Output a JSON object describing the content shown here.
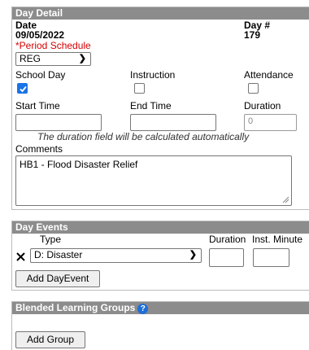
{
  "day_detail": {
    "title": "Day Detail",
    "date_label": "Date",
    "date_value": "09/05/2022",
    "day_num_label": "Day #",
    "day_num_value": "179",
    "period_schedule_label": "*Period Schedule",
    "period_schedule_value": "REG",
    "school_day_label": "School Day",
    "school_day_checked": true,
    "instruction_label": "Instruction",
    "instruction_checked": false,
    "attendance_label": "Attendance",
    "attendance_checked": false,
    "start_time_label": "Start Time",
    "start_time_value": "",
    "end_time_label": "End Time",
    "end_time_value": "",
    "duration_label": "Duration",
    "duration_value": "0",
    "duration_note": "The duration field will be calculated automatically",
    "comments_label": "Comments",
    "comments_value": "HB1 - Flood Disaster Relief"
  },
  "day_events": {
    "title": "Day Events",
    "type_header": "Type",
    "duration_header": "Duration",
    "inst_minutes_header": "Inst. Minute",
    "rows": [
      {
        "type_value": "D: Disaster",
        "duration": "",
        "inst_minutes": ""
      }
    ],
    "add_button": "Add DayEvent"
  },
  "blended_groups": {
    "title": "Blended Learning Groups",
    "help_icon": "?",
    "add_button": "Add Group"
  },
  "colors": {
    "header_bg": "#8c8c8c",
    "required_text": "#d40000",
    "checkbox_checked": "#1a73e8",
    "help_icon": "#1e6ed8"
  }
}
